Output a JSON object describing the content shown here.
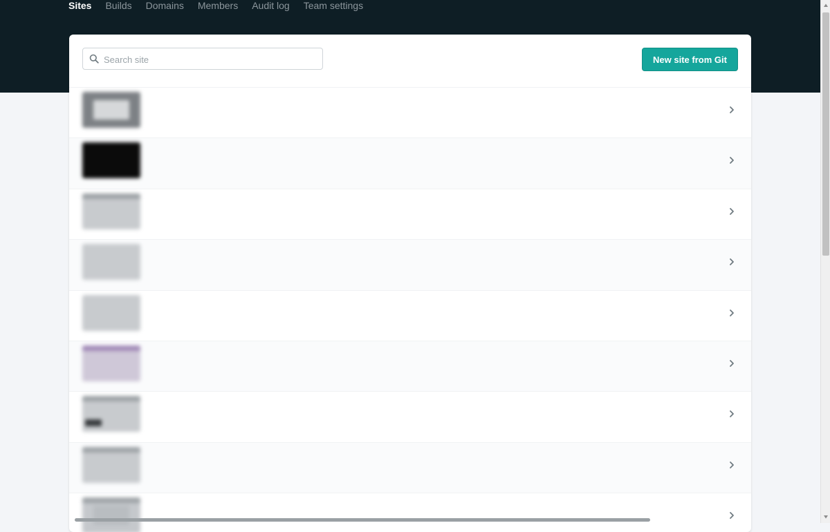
{
  "nav": {
    "tabs": [
      {
        "label": "Sites",
        "active": true
      },
      {
        "label": "Builds",
        "active": false
      },
      {
        "label": "Domains",
        "active": false
      },
      {
        "label": "Members",
        "active": false
      },
      {
        "label": "Audit log",
        "active": false
      },
      {
        "label": "Team settings",
        "active": false
      }
    ]
  },
  "search": {
    "placeholder": "Search site",
    "icon": "search-icon"
  },
  "toolbar": {
    "new_site_label": "New site from Git"
  },
  "colors": {
    "header_bg": "#0e1e25",
    "accent": "#15a69c",
    "page_bg": "#f3f5f8"
  },
  "sites": [
    {
      "name": "",
      "sub": "",
      "deploy": "",
      "time": ""
    },
    {
      "name": "",
      "sub": "",
      "deploy": "",
      "time": ""
    },
    {
      "name": "",
      "sub": "",
      "deploy": "",
      "time": ""
    },
    {
      "name": "",
      "sub": "",
      "deploy": "",
      "time": ""
    },
    {
      "name": "",
      "sub": "",
      "deploy": "",
      "time": ""
    },
    {
      "name": "",
      "sub": "",
      "deploy": "",
      "time": ""
    },
    {
      "name": "",
      "sub": "",
      "deploy": "",
      "time": ""
    },
    {
      "name": "",
      "sub": "",
      "deploy": "",
      "time": ""
    },
    {
      "name": "",
      "sub": "",
      "deploy": "",
      "time": ""
    }
  ]
}
